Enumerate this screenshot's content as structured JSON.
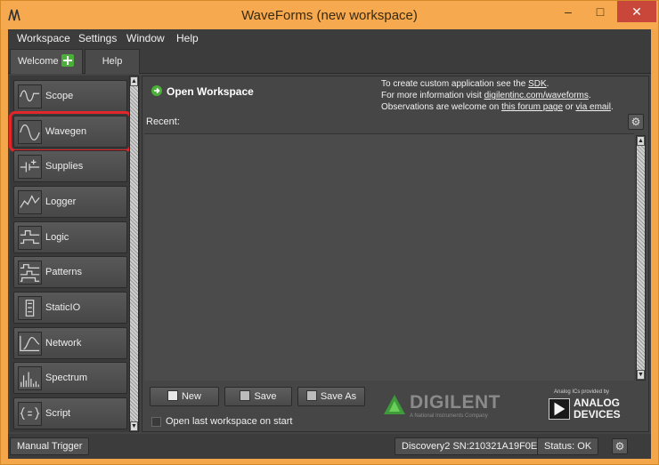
{
  "window": {
    "title": "WaveForms  (new workspace)",
    "min_glyph": "–",
    "max_glyph": "□",
    "close_glyph": "✕"
  },
  "menu": [
    {
      "label": "Workspace"
    },
    {
      "label": "Settings"
    },
    {
      "label": "Window"
    },
    {
      "label": "Help"
    }
  ],
  "tabs": {
    "welcome": "Welcome",
    "help": "Help"
  },
  "instruments": [
    {
      "label": "Scope",
      "icon": "scope-icon"
    },
    {
      "label": "Wavegen",
      "icon": "wavegen-icon",
      "selected": true
    },
    {
      "label": "Supplies",
      "icon": "supplies-icon"
    },
    {
      "label": "Logger",
      "icon": "logger-icon"
    },
    {
      "label": "Logic",
      "icon": "logic-icon"
    },
    {
      "label": "Patterns",
      "icon": "patterns-icon"
    },
    {
      "label": "StaticIO",
      "icon": "staticio-icon"
    },
    {
      "label": "Network",
      "icon": "network-icon"
    },
    {
      "label": "Spectrum",
      "icon": "spectrum-icon"
    },
    {
      "label": "Script",
      "icon": "script-icon"
    }
  ],
  "main": {
    "open_workspace": "Open Workspace",
    "info": {
      "line1_prefix": "To create custom application see the ",
      "line1_link": "SDK",
      "line1_suffix": ".",
      "line2_prefix": "For more information visit ",
      "line2_link": "digilentinc.com/waveforms",
      "line2_suffix": ".",
      "line3_prefix": "Observations are welcome on ",
      "line3_link1": "this forum page",
      "line3_mid": " or ",
      "line3_link2": "via email",
      "line3_suffix": "."
    },
    "recent_label": "Recent:",
    "buttons": {
      "new": "New",
      "save": "Save",
      "save_as": "Save As"
    },
    "open_last_label": "Open last workspace on start",
    "open_last_checked": false
  },
  "logos": {
    "digilent": "DIGILENT",
    "digilent_sub": "A National Instruments Company",
    "adi_top": "Analog ICs provided by",
    "adi_line1": "ANALOG",
    "adi_line2": "DEVICES"
  },
  "status": {
    "manual_trigger": "Manual Trigger",
    "device": "Discovery2 SN:210321A19F0E",
    "status": "Status: OK"
  },
  "colors": {
    "accent_green": "#4caf3a",
    "selection_red": "#e3262a",
    "titlebar": "#f6a94e"
  }
}
